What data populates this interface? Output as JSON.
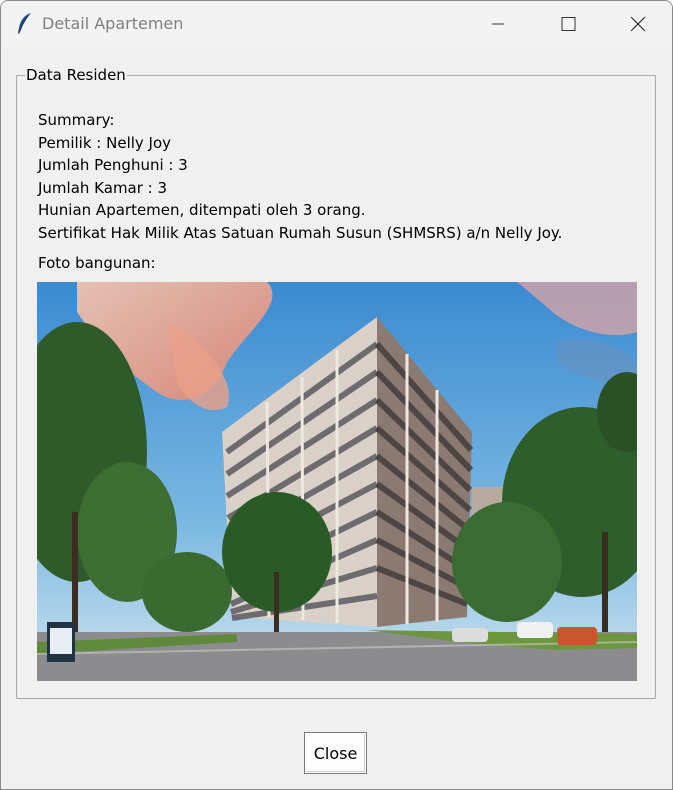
{
  "window": {
    "title": "Detail Apartemen",
    "icon": "feather-icon",
    "controls": [
      "minimize-icon",
      "maximize-icon",
      "close-icon"
    ]
  },
  "group": {
    "label": "Data Residen"
  },
  "summary": {
    "heading": "Summary:",
    "owner": "Pemilik : Nelly Joy",
    "occupants": "Jumlah Penghuni : 3",
    "rooms": "Jumlah Kamar : 3",
    "description": "Hunian Apartemen, ditempati oleh 3 orang.",
    "certificate": "Sertifikat Hak Milik Atas Satuan Rumah Susun (SHMSRS) a/n Nelly Joy."
  },
  "photo": {
    "label": "Foto bangunan:"
  },
  "actions": {
    "close_label": "Close"
  },
  "colors": {
    "window_bg": "#f0f0f0",
    "sky": "#3f8fd0",
    "cloud": "#f2a38c"
  }
}
